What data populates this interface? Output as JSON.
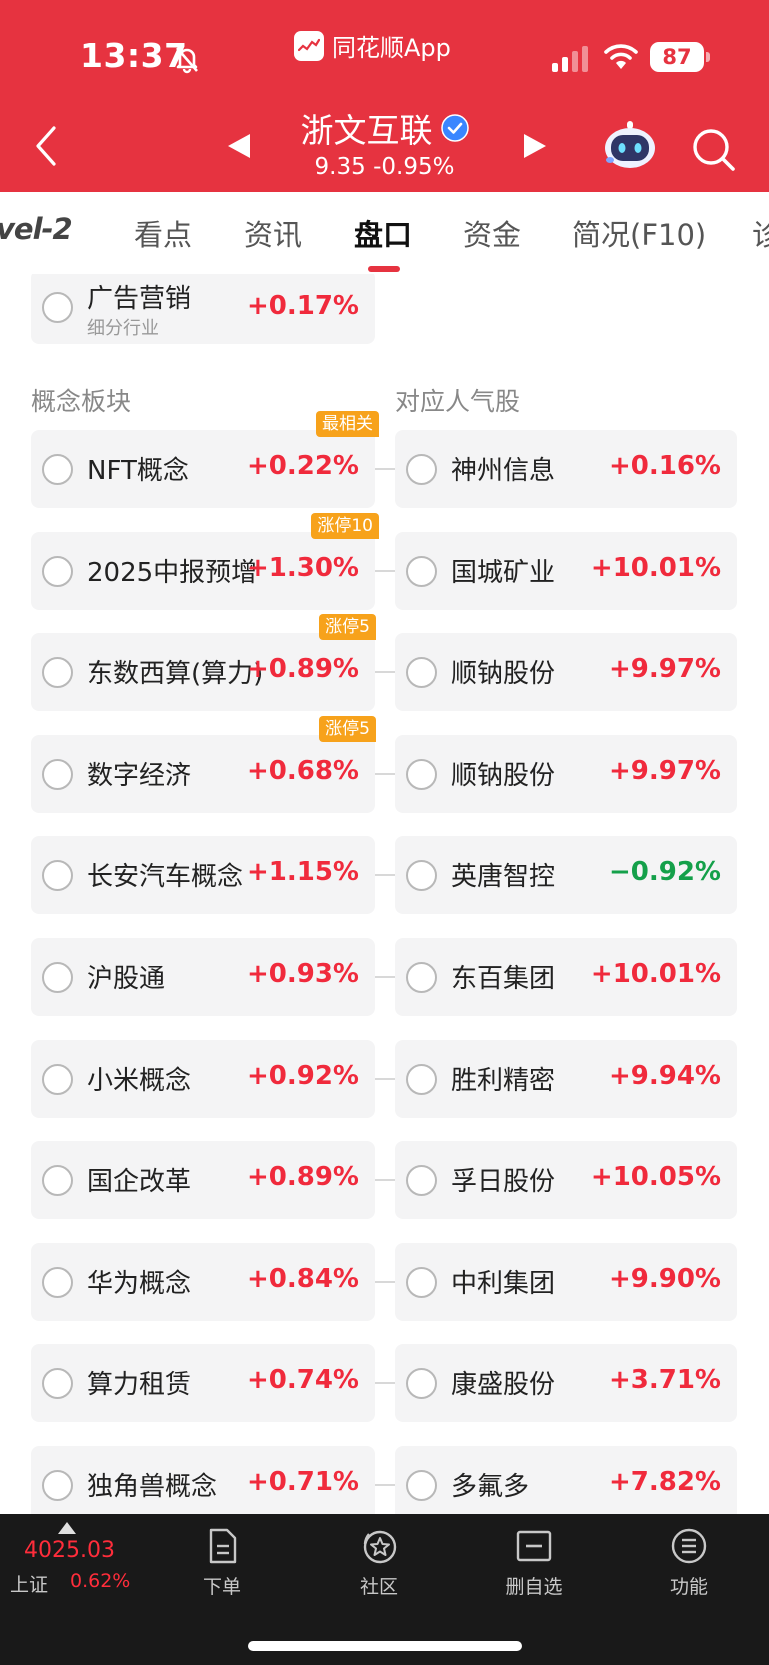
{
  "status_bar": {
    "time": "13:37",
    "battery": "87",
    "app_name": "同花顺App"
  },
  "header": {
    "stock_name": "浙文互联",
    "price_line": "9.35 -0.95%"
  },
  "tabs": [
    "vel-2",
    "看点",
    "资讯",
    "盘口",
    "资金",
    "简况(F10)",
    "诊"
  ],
  "active_tab": "盘口",
  "industry_card": {
    "name": "广告营销",
    "sublabel": "细分行业",
    "change": "+0.17%"
  },
  "sections": {
    "concept_label": "概念板块",
    "stocks_label": "对应人气股"
  },
  "rows": [
    {
      "concept": "NFT概念",
      "concept_change": "+0.22%",
      "tag": "最相关",
      "stock": "神州信息",
      "stock_change": "+0.16%"
    },
    {
      "concept": "2025中报预增",
      "concept_change": "+1.30%",
      "tag": "涨停10",
      "stock": "国城矿业",
      "stock_change": "+10.01%"
    },
    {
      "concept": "东数西算(算力)",
      "concept_change": "+0.89%",
      "tag": "涨停5",
      "stock": "顺钠股份",
      "stock_change": "+9.97%"
    },
    {
      "concept": "数字经济",
      "concept_change": "+0.68%",
      "tag": "涨停5",
      "stock": "顺钠股份",
      "stock_change": "+9.97%"
    },
    {
      "concept": "长安汽车概念",
      "concept_change": "+1.15%",
      "tag": "",
      "stock": "英唐智控",
      "stock_change": "−0.92%"
    },
    {
      "concept": "沪股通",
      "concept_change": "+0.93%",
      "tag": "",
      "stock": "东百集团",
      "stock_change": "+10.01%"
    },
    {
      "concept": "小米概念",
      "concept_change": "+0.92%",
      "tag": "",
      "stock": "胜利精密",
      "stock_change": "+9.94%"
    },
    {
      "concept": "国企改革",
      "concept_change": "+0.89%",
      "tag": "",
      "stock": "孚日股份",
      "stock_change": "+10.05%"
    },
    {
      "concept": "华为概念",
      "concept_change": "+0.84%",
      "tag": "",
      "stock": "中利集团",
      "stock_change": "+9.90%"
    },
    {
      "concept": "算力租赁",
      "concept_change": "+0.74%",
      "tag": "",
      "stock": "康盛股份",
      "stock_change": "+3.71%"
    },
    {
      "concept": "独角兽概念",
      "concept_change": "+0.71%",
      "tag": "",
      "stock": "多氟多",
      "stock_change": "+7.82%"
    }
  ],
  "bottom_bar": {
    "index_value": "4025.03",
    "index_name": "上证",
    "index_change": "0.62%",
    "nav": [
      "下单",
      "社区",
      "删自选",
      "功能"
    ]
  },
  "colors": {
    "header_red": "#e63340",
    "up_red": "#f02a3c",
    "down_green": "#14a04a",
    "tag_orange": "#f7a21b"
  }
}
